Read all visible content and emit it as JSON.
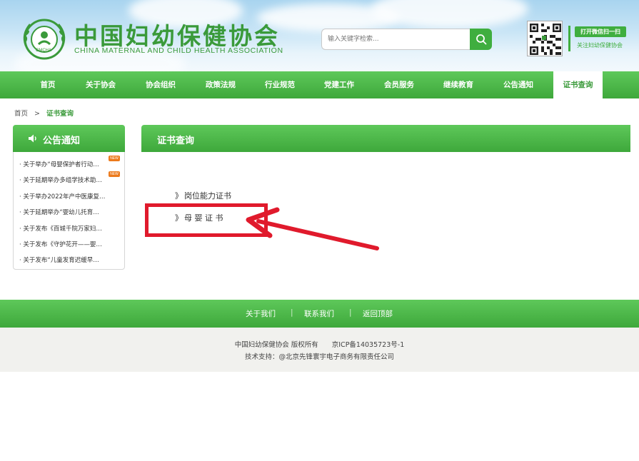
{
  "site": {
    "title_cn": "中国妇幼保健协会",
    "title_en": "CHINA MATERNAL AND CHILD HEALTH ASSOCIATION",
    "logo_text": "CMCHA"
  },
  "search": {
    "placeholder": "输入关键字检索...",
    "icon": "search-icon"
  },
  "wechat": {
    "button_label": "打开微信扫一扫",
    "follow_label": "关注妇幼保健协会"
  },
  "nav": {
    "items": [
      {
        "label": "首页"
      },
      {
        "label": "关于协会"
      },
      {
        "label": "协会组织"
      },
      {
        "label": "政策法规"
      },
      {
        "label": "行业规范"
      },
      {
        "label": "党建工作"
      },
      {
        "label": "会员服务"
      },
      {
        "label": "继续教育"
      },
      {
        "label": "公告通知"
      },
      {
        "label": "证书查询"
      }
    ],
    "active": "证书查询"
  },
  "breadcrumb": {
    "home": "首页",
    "sep": ">",
    "current": "证书查询"
  },
  "sidebar": {
    "title": "公告通知",
    "items": [
      {
        "text": "· 关于举办“母婴保护者行动…",
        "badge": "NEW"
      },
      {
        "text": "· 关于延期举办多组学技术助…",
        "badge": "NEW"
      },
      {
        "text": "· 关于举办2022年产中医康复…"
      },
      {
        "text": "· 关于延期举办“婴幼儿托育…"
      },
      {
        "text": "· 关于发布《百城千院万家妇…"
      },
      {
        "text": "· 关于发布《守护花开——婴…"
      },
      {
        "text": "· 关于发布“儿童发育迟缓早…"
      }
    ]
  },
  "main": {
    "title": "证书查询",
    "links": [
      {
        "mark": "》",
        "label": "岗位能力证书"
      },
      {
        "mark": "》",
        "label": "母 婴 证 书"
      }
    ]
  },
  "footer": {
    "links": [
      "关于我们",
      "联系我们",
      "返回顶部"
    ],
    "sep": "|",
    "copyright": "中国妇幼保健协会 版权所有　　京ICP备14035723号-1",
    "tech": "技术支持：@北京先锋寰宇电子商务有限责任公司"
  },
  "colors": {
    "brand_green": "#3ea83b",
    "annotation_red": "#e01a2c"
  }
}
